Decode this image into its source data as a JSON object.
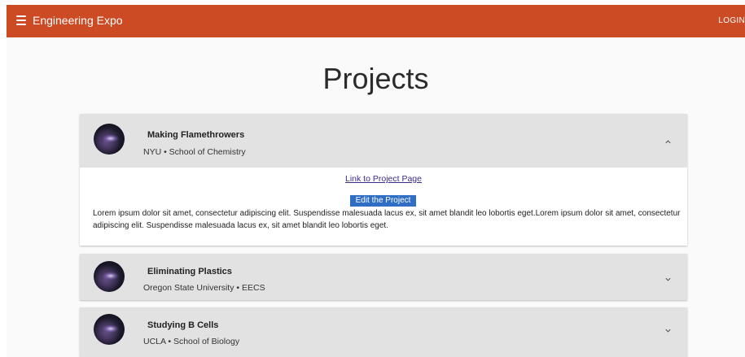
{
  "app": {
    "title": "Engineering Expo",
    "login_label": "LOGIN"
  },
  "page": {
    "title": "Projects"
  },
  "projects": [
    {
      "title": "Making Flamethrowers",
      "subtitle": "NYU • School of Chemistry",
      "expanded": true,
      "link_label": "Link to Project Page",
      "edit_label": "Edit the Project",
      "description": "Lorem ipsum dolor sit amet, consectetur adipiscing elit. Suspendisse malesuada lacus ex, sit amet blandit leo lobortis eget.Lorem ipsum dolor sit amet, consectetur adipiscing elit. Suspendisse malesuada lacus ex, sit amet blandit leo lobortis eget.",
      "avatar_icon": "galaxy-avatar",
      "toggle_icon": "chevron-up-icon"
    },
    {
      "title": "Eliminating Plastics",
      "subtitle": "Oregon State University • EECS",
      "expanded": false,
      "avatar_icon": "galaxy-avatar",
      "toggle_icon": "chevron-down-icon"
    },
    {
      "title": "Studying B Cells",
      "subtitle": "UCLA • School of Biology",
      "expanded": false,
      "avatar_icon": "galaxy-avatar",
      "toggle_icon": "chevron-down-icon"
    }
  ],
  "colors": {
    "appbar": "#cc4a24",
    "card_header": "#e2e2e2",
    "edit_button": "#2f6ec4",
    "link": "#3b2b8a"
  }
}
